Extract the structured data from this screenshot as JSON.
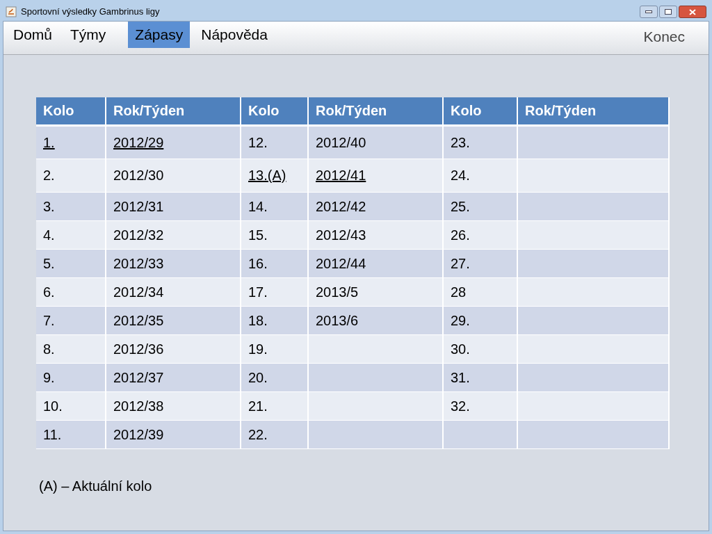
{
  "window": {
    "title": "Sportovní výsledky Gambrinus ligy"
  },
  "menu": [
    {
      "label": "Domů",
      "selected": false
    },
    {
      "label": "Týmy",
      "selected": false
    },
    {
      "label": "Zápasy",
      "selected": true
    },
    {
      "label": "Nápověda",
      "selected": false
    }
  ],
  "exit": "Konec",
  "table": {
    "columns": [
      "Kolo",
      "Rok/Týden",
      "Kolo",
      "Rok/Týden",
      "Kolo",
      "Rok/Týden"
    ],
    "rows": [
      [
        {
          "text": "1.",
          "link": true
        },
        {
          "text": "2012/29",
          "link": true
        },
        {
          "text": "12.",
          "link": false
        },
        {
          "text": "2012/40",
          "link": false
        },
        {
          "text": "23.",
          "link": false
        },
        null
      ],
      [
        {
          "text": "2.",
          "link": false
        },
        {
          "text": "2012/30",
          "link": false
        },
        {
          "text": "13.(A)",
          "link": true
        },
        {
          "text": "2012/41",
          "link": true
        },
        {
          "text": "24.",
          "link": false
        },
        null
      ],
      [
        {
          "text": "3.",
          "link": false
        },
        {
          "text": "2012/31",
          "link": false
        },
        {
          "text": "14.",
          "link": false
        },
        {
          "text": "2012/42",
          "link": false
        },
        {
          "text": "25.",
          "link": false
        },
        null
      ],
      [
        {
          "text": "4.",
          "link": false
        },
        {
          "text": "2012/32",
          "link": false
        },
        {
          "text": "15.",
          "link": false
        },
        {
          "text": "2012/43",
          "link": false
        },
        {
          "text": "26.",
          "link": false
        },
        null
      ],
      [
        {
          "text": "5.",
          "link": false
        },
        {
          "text": "2012/33",
          "link": false
        },
        {
          "text": "16.",
          "link": false
        },
        {
          "text": "2012/44",
          "link": false
        },
        {
          "text": "27.",
          "link": false
        },
        null
      ],
      [
        {
          "text": "6.",
          "link": false
        },
        {
          "text": "2012/34",
          "link": false
        },
        {
          "text": "17.",
          "link": false
        },
        {
          "text": "2013/5",
          "link": false
        },
        {
          "text": "28",
          "link": false
        },
        null
      ],
      [
        {
          "text": "7.",
          "link": false
        },
        {
          "text": "2012/35",
          "link": false
        },
        {
          "text": "18.",
          "link": false
        },
        {
          "text": "2013/6",
          "link": false
        },
        {
          "text": "29.",
          "link": false
        },
        null
      ],
      [
        {
          "text": "8.",
          "link": false
        },
        {
          "text": "2012/36",
          "link": false
        },
        {
          "text": "19.",
          "link": false
        },
        null,
        {
          "text": "30.",
          "link": false
        },
        null
      ],
      [
        {
          "text": "9.",
          "link": false
        },
        {
          "text": "2012/37",
          "link": false
        },
        {
          "text": "20.",
          "link": false
        },
        null,
        {
          "text": "31.",
          "link": false
        },
        null
      ],
      [
        {
          "text": "10.",
          "link": false
        },
        {
          "text": "2012/38",
          "link": false
        },
        {
          "text": "21.",
          "link": false
        },
        null,
        {
          "text": "32.",
          "link": false
        },
        null
      ],
      [
        {
          "text": "11.",
          "link": false
        },
        {
          "text": "2012/39",
          "link": false
        },
        {
          "text": "22.",
          "link": false
        },
        null,
        null,
        null
      ]
    ]
  },
  "legend": "(A) – Aktuální kolo"
}
